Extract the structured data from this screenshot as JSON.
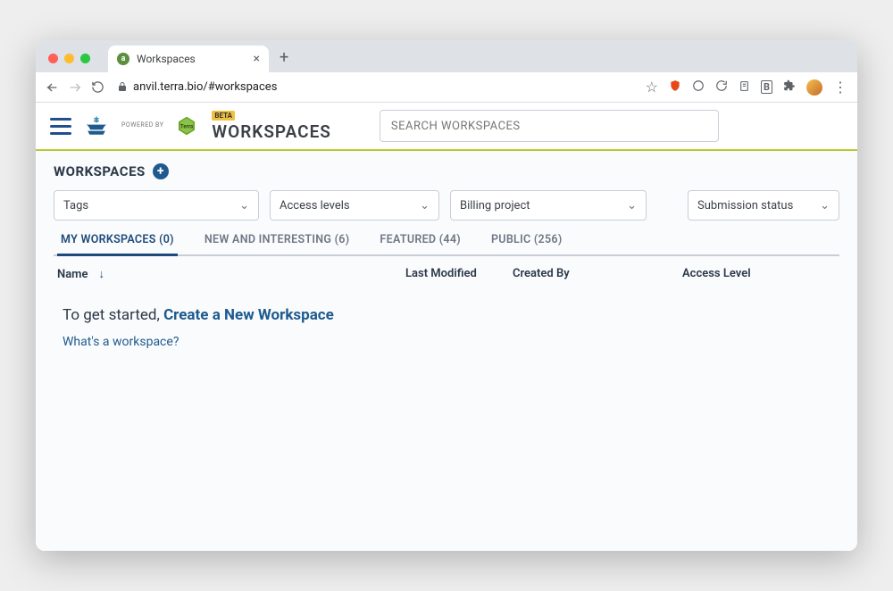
{
  "browser": {
    "tab_title": "Workspaces",
    "url": "anvil.terra.bio/#workspaces"
  },
  "header": {
    "powered_by": "POWERED BY",
    "beta": "BETA",
    "title": "WORKSPACES",
    "search_placeholder": "SEARCH WORKSPACES"
  },
  "page": {
    "title": "WORKSPACES",
    "filters": {
      "tags": "Tags",
      "access": "Access levels",
      "billing": "Billing project",
      "submission": "Submission status"
    },
    "tabs": {
      "my": "MY WORKSPACES (0)",
      "new": "NEW AND INTERESTING (6)",
      "featured": "FEATURED (44)",
      "public": "PUBLIC (256)"
    },
    "columns": {
      "name": "Name",
      "modified": "Last Modified",
      "created": "Created By",
      "access": "Access Level"
    },
    "empty": {
      "prefix": "To get started, ",
      "create": "Create a New Workspace",
      "help": "What's a workspace?"
    }
  }
}
